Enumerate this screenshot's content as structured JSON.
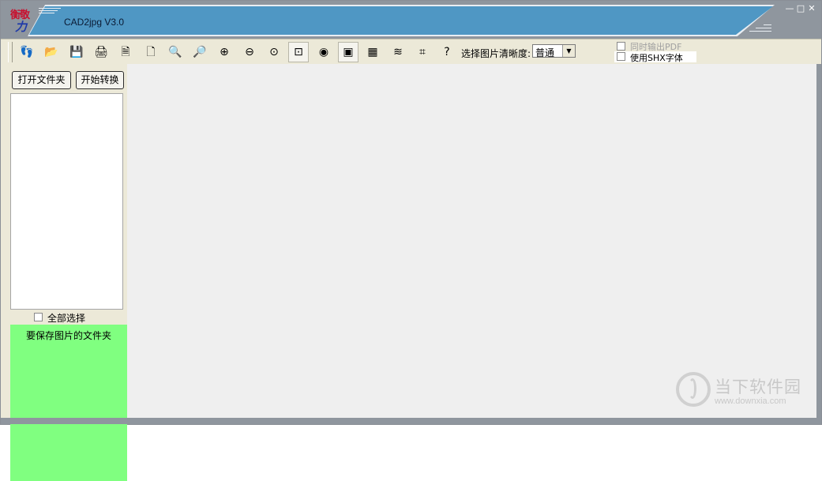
{
  "window": {
    "title": "CAD2jpg V3.0",
    "logo_text_top": "衡敬",
    "logo_text_bottom": "力",
    "controls": {
      "minimize": "—",
      "maximize": "□",
      "close": "✕"
    }
  },
  "toolbar": {
    "buttons": [
      {
        "icon": "footprints-icon",
        "glyph": "👣",
        "pressed": false
      },
      {
        "icon": "open-folder-icon",
        "glyph": "📂",
        "pressed": false
      },
      {
        "icon": "save-icon",
        "glyph": "💾",
        "pressed": false
      },
      {
        "icon": "print-icon",
        "glyph": "🖨",
        "pressed": false
      },
      {
        "icon": "print-preview-icon",
        "glyph": "🗎",
        "pressed": false
      },
      {
        "icon": "copy-page-icon",
        "glyph": "🗋",
        "pressed": false
      },
      {
        "icon": "search-icon",
        "glyph": "🔍",
        "pressed": false
      },
      {
        "icon": "zoom-back-icon",
        "glyph": "🔎",
        "pressed": false
      },
      {
        "icon": "zoom-in-icon",
        "glyph": "⊕",
        "pressed": false
      },
      {
        "icon": "zoom-out-icon",
        "glyph": "⊖",
        "pressed": false
      },
      {
        "icon": "zoom-realtime-icon",
        "glyph": "⊙",
        "pressed": false
      },
      {
        "icon": "zoom-window-icon",
        "glyph": "⊡",
        "pressed": true
      },
      {
        "icon": "zoom-extents-icon",
        "glyph": "◉",
        "pressed": false
      },
      {
        "icon": "layers-window-icon",
        "glyph": "▣",
        "pressed": true
      },
      {
        "icon": "color-icon",
        "glyph": "▦",
        "pressed": false
      },
      {
        "icon": "layer-stack-icon",
        "glyph": "≋",
        "pressed": false
      },
      {
        "icon": "crop-icon",
        "glyph": "⌗",
        "pressed": false
      },
      {
        "icon": "help-icon",
        "glyph": "?",
        "pressed": false
      }
    ],
    "quality_label": "选择图片清晰度:",
    "quality_value": "普通",
    "output_pdf_label": "同时输出PDF",
    "use_shx_label": "使用SHX字体"
  },
  "left_panel": {
    "open_folder_button": "打开文件夹",
    "start_convert_button": "开始转换",
    "select_all_label": "全部选择",
    "save_folder_label": "要保存图片的文件夹"
  },
  "watermark": {
    "name": "当下软件园",
    "url": "www.downxia.com"
  },
  "colors": {
    "title_blue": "#4f97c4",
    "frame_gray": "#8f969e",
    "toolbar_bg": "#ece9d8",
    "save_folder_bg": "#80ff80",
    "canvas_bg": "#efefef"
  }
}
